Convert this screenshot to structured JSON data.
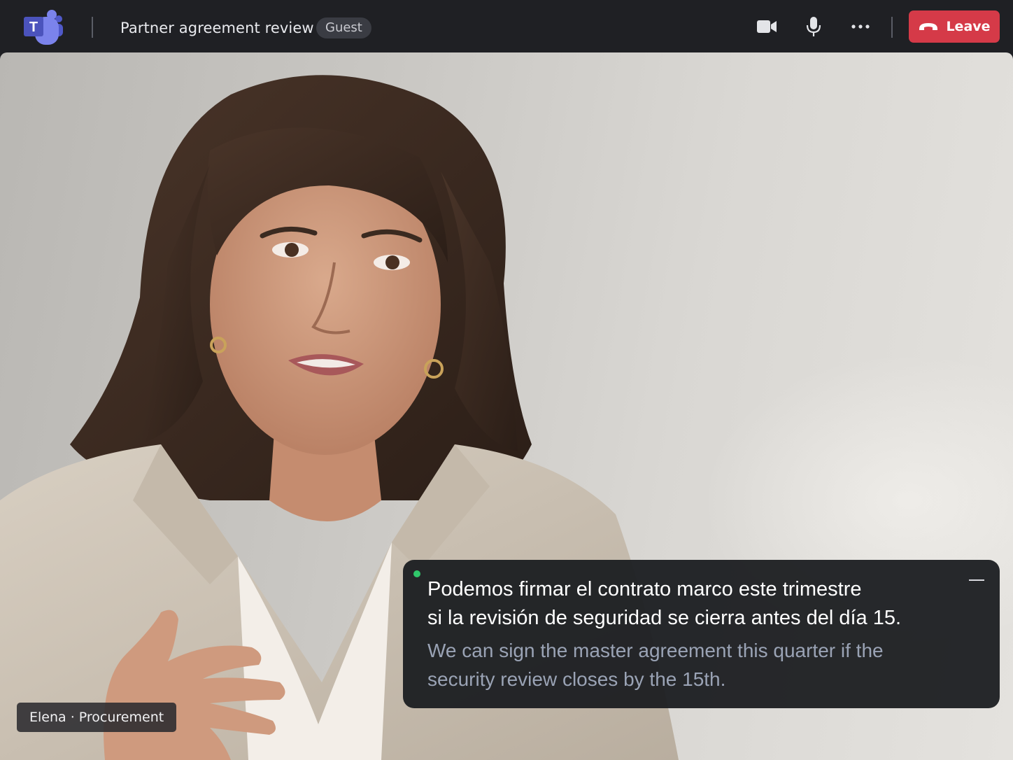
{
  "app": {
    "logo_letter": "T",
    "meeting_title": "Partner agreement review",
    "role_badge": "Guest"
  },
  "toolbar": {
    "camera_icon": "camera-icon",
    "mic_icon": "microphone-icon",
    "more_icon": "more-options-icon",
    "leave_label": "Leave",
    "leave_icon": "phone-hangup-icon"
  },
  "colors": {
    "leave": "#d53a48",
    "live_indicator": "#30c76a",
    "translated_text": "#9aa3b5"
  },
  "video": {
    "participant_label": "Elena · Procurement"
  },
  "captions": {
    "original": [
      "Podemos firmar el contrato marco este trimestre",
      "si la revisión de seguridad se cierra antes del día 15."
    ],
    "translated": [
      "We can sign the master agreement this quarter if the",
      "security review closes by the 15th."
    ]
  }
}
